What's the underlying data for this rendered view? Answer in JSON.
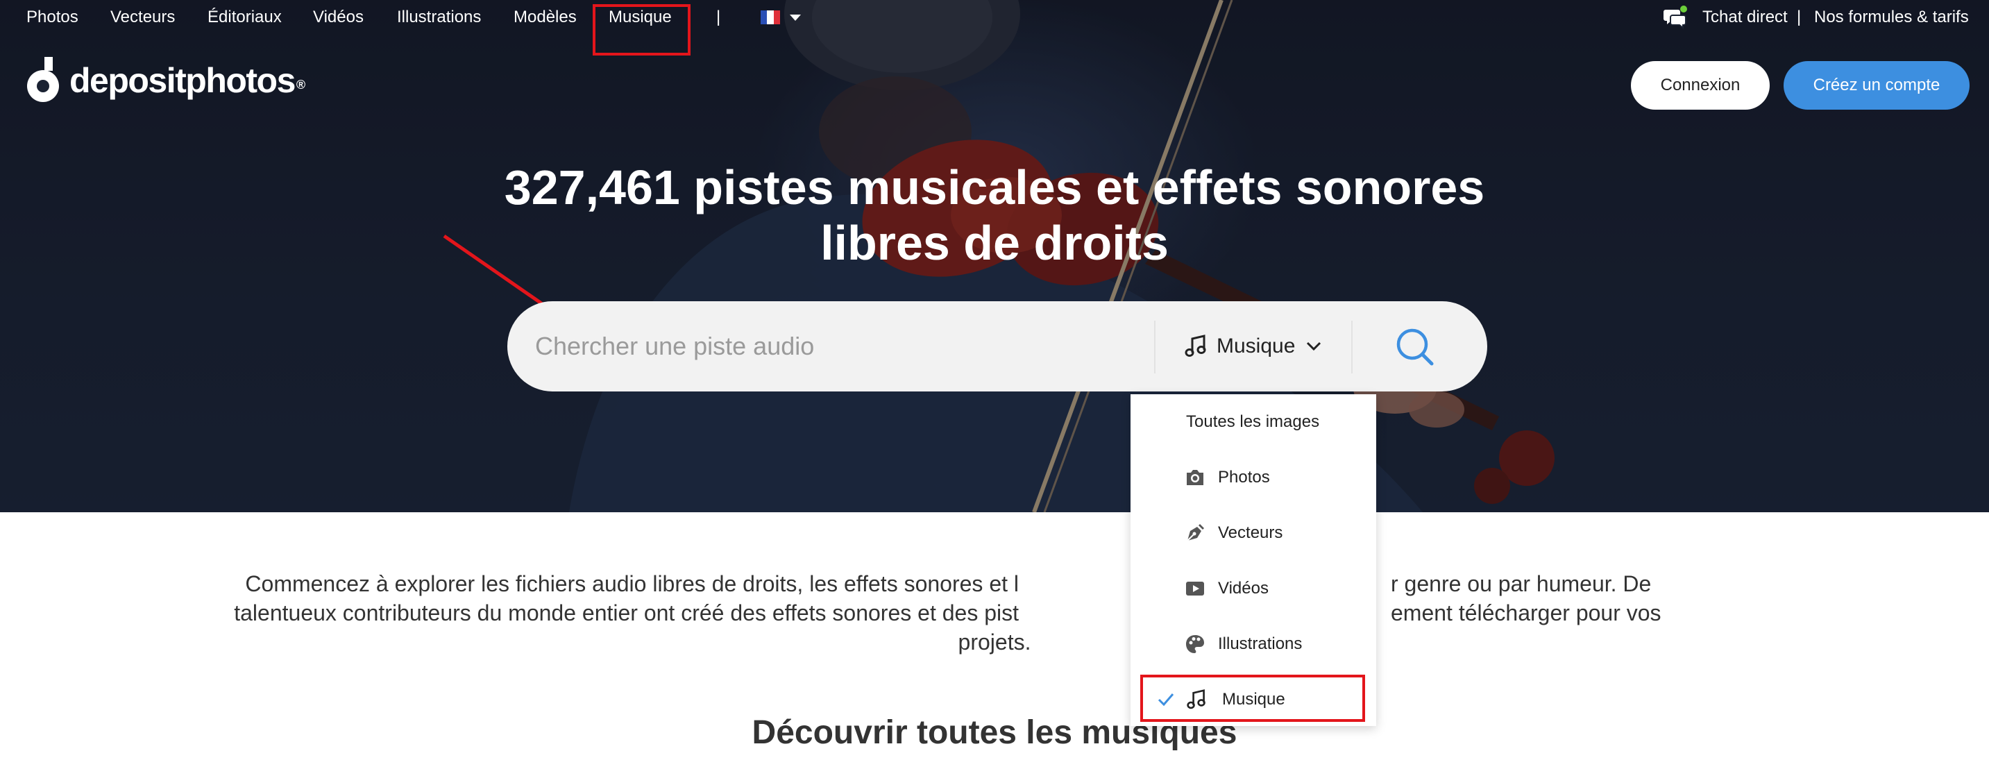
{
  "nav": {
    "items": [
      {
        "label": "Photos"
      },
      {
        "label": "Vecteurs"
      },
      {
        "label": "Éditoriaux"
      },
      {
        "label": "Vidéos"
      },
      {
        "label": "Illustrations"
      },
      {
        "label": "Modèles"
      },
      {
        "label": "Musique"
      }
    ],
    "separator": "|",
    "language_flag": "fr-flag-icon",
    "right": {
      "chat": "Tchat direct",
      "separator": "|",
      "pricing": "Nos formules & tarifs"
    }
  },
  "logo": {
    "text": "depositphotos",
    "registered": "®"
  },
  "auth": {
    "login": "Connexion",
    "signup": "Créez un compte"
  },
  "hero": {
    "title_line1": "327,461 pistes musicales et effets sonores",
    "title_line2": "libres de droits"
  },
  "search": {
    "placeholder": "Chercher une piste audio",
    "type_selected": "Musique"
  },
  "dropdown": {
    "items": [
      {
        "label": "Toutes les images",
        "icon": null
      },
      {
        "label": "Photos",
        "icon": "camera-icon"
      },
      {
        "label": "Vecteurs",
        "icon": "pen-icon"
      },
      {
        "label": "Vidéos",
        "icon": "play-icon"
      },
      {
        "label": "Illustrations",
        "icon": "palette-icon"
      },
      {
        "label": "Musique",
        "icon": "music-note-icon",
        "selected": true
      }
    ]
  },
  "intro": {
    "line1_a": "Commencez à explorer les fichiers audio libres de droits, les effets sonores et l",
    "line1_b": "r genre ou par humeur. De",
    "line2_a": "talentueux contributeurs du monde entier ont créé des effets sonores et des pist",
    "line2_b": "ement télécharger pour vos",
    "line3": "projets."
  },
  "section": {
    "title": "Découvrir toutes les musiques"
  },
  "colors": {
    "accent": "#3d8fe0",
    "highlight": "#e3151b",
    "hero_bg": "#1a2232"
  }
}
